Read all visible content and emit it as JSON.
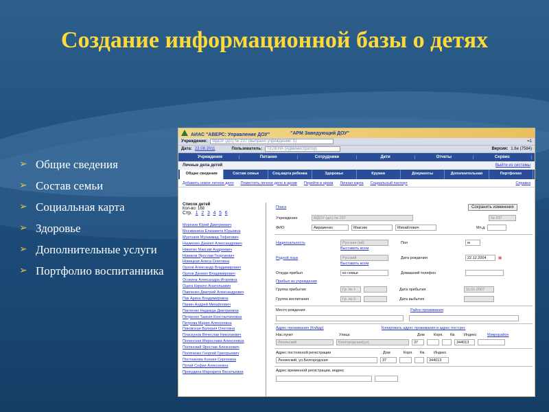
{
  "slide": {
    "title": "Создание информационной базы о детях",
    "bullets": [
      "Общие сведения",
      "Состав семьи",
      "Социальная карта",
      "Здоровье",
      "Дополнительные услуги",
      "Портфолио воспитанника"
    ],
    "bullet_icon": "arrow-bullet-icon"
  },
  "app": {
    "title": "АИАС \"АВЕРС: Управление ДОУ\"",
    "module": "\"АРМ Заведующий ДОУ\"",
    "row1": {
      "label": "Учреждение:",
      "value": "МДОУ (д/с) № 237 (выбрано учреждений: 1)",
      "right": "=1"
    },
    "row2": {
      "date_label": "Дата:",
      "date": "22.08.2011",
      "user_label": "Пользователь:",
      "user": "ТЕЛЕНА (Администратор)",
      "version_label": "Версия:",
      "version": "1.6e (7584)"
    },
    "menu": [
      "Учреждение",
      "Питание",
      "Сотрудники",
      "Дети",
      "Отчеты",
      "Сервис"
    ],
    "section_title": "Личные дела детей",
    "exit": "Выйти из системы",
    "tabs": [
      "Общие сведения",
      "Состав семьи",
      "Соц.карта ребенка",
      "Здоровье",
      "Кружки",
      "Документы",
      "Дополнительная информация",
      "Портфолио"
    ],
    "links": [
      "Добавить новое личное дело",
      "Поместить личное дело в архив",
      "Перейти в архив",
      "Личная карта",
      "Социальный паспорт",
      "Справка"
    ],
    "list": {
      "title": "Список детей",
      "count": "Кол-во: 168",
      "pages_label": "Стр.",
      "pages": [
        "1",
        "2",
        "3",
        "4",
        "5",
        "6"
      ],
      "names": [
        "Морозов Юрий Дмитриевич",
        "Москвинина Елизавета Юрьевна",
        "Муртазов Мухаммад Тофигович",
        "Науменко Даниил Александрович",
        "Никитин Максим Андреевич",
        "Новиков Ярослав Георгиевич",
        "Новицкая Алиса Олеговна",
        "Орлов Александр Владимирович",
        "Орлов Даниил Владимирович",
        "Осокина Александра Игоревна",
        "Оцега Кирилл Анатольевич",
        "Павленко Дмитрий Александрович",
        "Пак Арина Владимировна",
        "Панин Андрей Михайлович",
        "Пантенко Надежда Дмитриевна",
        "Петренко Таисия Константиновна",
        "Петрова Мария Алексеевна",
        "Пиковская Валерия Олеговна",
        "Пласкунов Вячеслав Николаевич",
        "Поленская Мирослава Алексеевна",
        "Полянский Ярослав Алексеевич",
        "Поляченко Георгий Григорьевич",
        "Постникова Ксения Сергеевна",
        "Потий София Алексеевна",
        "Прокудина Маргарита Васильевна"
      ]
    },
    "form": {
      "search": "Поиск",
      "save": "Сохранить изменения",
      "institution_label": "Учреждение",
      "institution": "МДОУ (д/с) № 237",
      "group_num": "№ 237",
      "fio_label": "ФИО",
      "last": "Авраменко",
      "first": "Максим",
      "middle": "Михайлович",
      "mpd_label": "Мn.д",
      "nationality_label": "Национальность",
      "nationality": "Русская (ий)",
      "choose_all": "Выставить всем",
      "sex_label": "Пол",
      "sex": "м",
      "native_label": "Родной язык",
      "native": "Русский",
      "birth_label": "Дата рождения",
      "birth": "22.12.2004",
      "from_label": "Откуда прибыл",
      "from": "из семьи",
      "home_phone_label": "Домашний телефон",
      "arrived_label": "Прибыл из учреждения",
      "arr_group_label": "Группа прибытия",
      "arr_group": "Гр. № 1",
      "arr_date_label": "Дата прибытия",
      "arr_date": "11.01.2007",
      "edu_group_label": "Группа воспитания",
      "edu_group": "Гр. № 5",
      "leave_date_label": "Дата выбытия",
      "birthplace_label": "Место рождения",
      "birth_region": "Район проживания",
      "address_label": "Адрес проживания (КлАдр)",
      "copy_address": "Копировать адрес проживания в адрес пост.рег.",
      "city_label": "Нас.пункт",
      "street_label": "Улица",
      "house_label": "Дом",
      "korp_label": "Корп.",
      "flat_label": "Кв.",
      "index_label": "Индекс",
      "microdistrict": "Микрорайон",
      "city": "Ленинский",
      "street": "Белгородская(ул)",
      "house": "37",
      "index": "344013",
      "reg_label": "Адрес постоянной регистрации",
      "reg_addr": "Ленинский, ул.Белгородская",
      "reg_house": "37",
      "reg_index": "344013",
      "temp_reg_label": "Адрес временной регистрации, индекс"
    }
  },
  "colors": {
    "title": "#ffd83a",
    "bullet_arrow": "#e8c04a",
    "menu": "#2a4d9a"
  }
}
